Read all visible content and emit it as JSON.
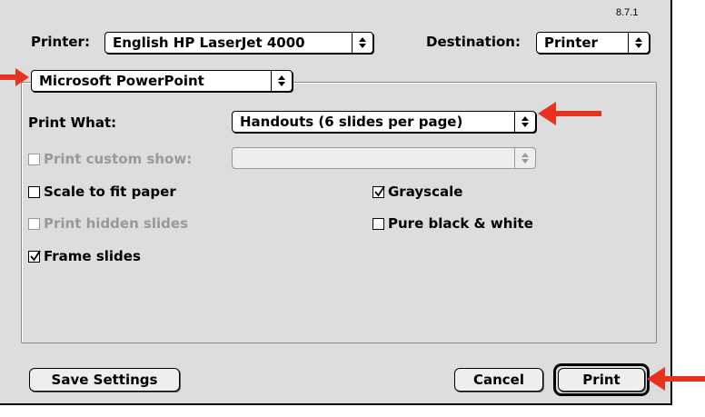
{
  "version": "8.7.1",
  "printer": {
    "label": "Printer:",
    "value": "English HP LaserJet 4000"
  },
  "destination": {
    "label": "Destination:",
    "value": "Printer"
  },
  "app_panel": {
    "value": "Microsoft PowerPoint"
  },
  "print_what": {
    "label": "Print What:",
    "value": "Handouts (6 slides per page)"
  },
  "custom_show": {
    "label": "Print custom show:",
    "value": "",
    "checked": false,
    "enabled": false
  },
  "options": {
    "scale_to_fit": {
      "label": "Scale to fit paper",
      "checked": false,
      "enabled": true
    },
    "print_hidden": {
      "label": "Print hidden slides",
      "checked": false,
      "enabled": false
    },
    "frame_slides": {
      "label": "Frame slides",
      "checked": true,
      "enabled": true
    },
    "grayscale": {
      "label": "Grayscale",
      "checked": true,
      "enabled": true
    },
    "pure_bw": {
      "label": "Pure black & white",
      "checked": false,
      "enabled": true
    }
  },
  "buttons": {
    "save_settings": "Save Settings",
    "cancel": "Cancel",
    "print": "Print"
  },
  "colors": {
    "dialog_bg": "#dddddd",
    "annotation_arrow": "#e8321e",
    "disabled_text": "#999999"
  }
}
